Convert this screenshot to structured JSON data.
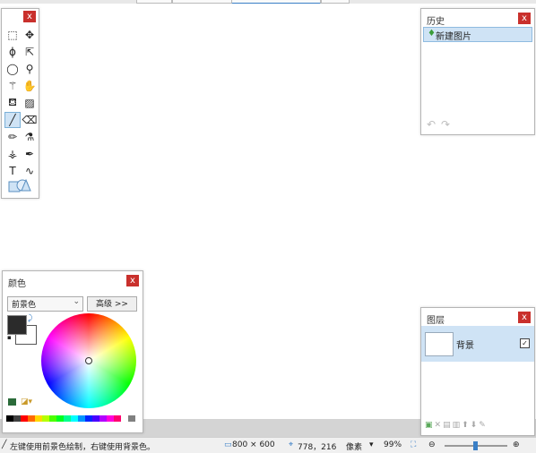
{
  "tools": {
    "grid": [
      [
        "select-rect",
        "move-selection"
      ],
      [
        "lasso",
        "move-selected"
      ],
      [
        "ellipse-select",
        "zoom"
      ],
      [
        "magic-wand",
        "pan"
      ],
      [
        "paint-bucket",
        "gradient"
      ],
      [
        "paintbrush",
        "eraser"
      ],
      [
        "pencil",
        "color-picker"
      ],
      [
        "clone-stamp",
        "recolor"
      ],
      [
        "text",
        "line-curve"
      ]
    ],
    "shapes": "shapes",
    "selected": "paintbrush"
  },
  "history": {
    "title": "历史",
    "close": "x",
    "items": [
      "新建图片"
    ]
  },
  "colors": {
    "title": "颜色",
    "close": "x",
    "mode_value": "前景色",
    "more_label": "高级 >>",
    "primary": "#2b2b2b",
    "secondary": "#ffffff",
    "palette": [
      "#000000",
      "#404040",
      "#ff0000",
      "#ff6a00",
      "#ffd800",
      "#b6ff00",
      "#4cff00",
      "#00ff21",
      "#00ff90",
      "#00ffff",
      "#0094ff",
      "#0026ff",
      "#4800ff",
      "#b200ff",
      "#ff00dc",
      "#ff006e",
      "#ffffff",
      "#808080"
    ]
  },
  "layers": {
    "title": "图层",
    "close": "x",
    "items": [
      {
        "name": "背景",
        "visible": true
      }
    ]
  },
  "status": {
    "hint": "左键使用前景色绘制，右键使用背景色。",
    "size": "800 × 600",
    "cursor": "778，216",
    "unit": "像素",
    "zoom": "99%"
  }
}
